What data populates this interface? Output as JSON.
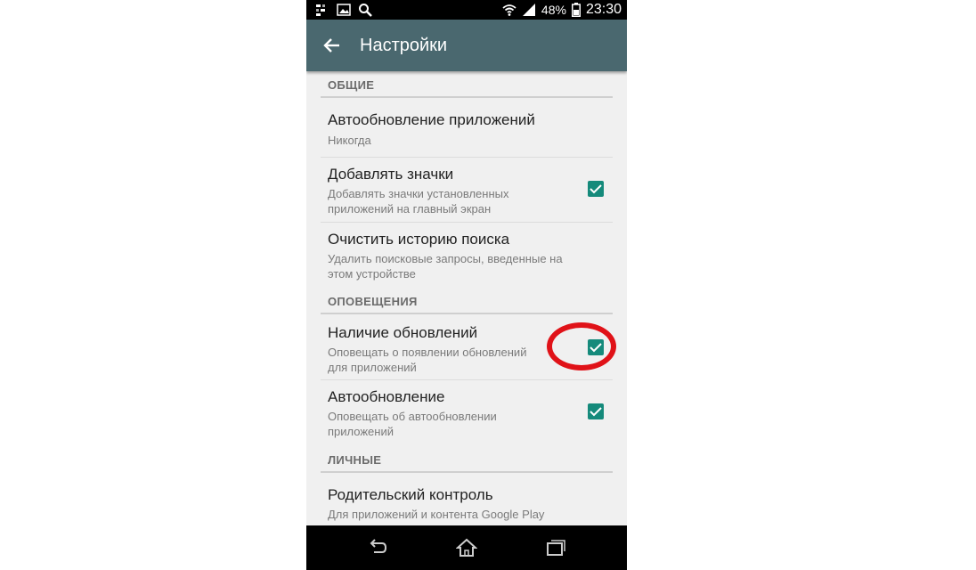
{
  "status_bar": {
    "battery": "48%",
    "time": "23:30",
    "icons": [
      "notification-icon",
      "image-icon",
      "search-icon",
      "wifi-icon",
      "signal-icon",
      "battery-icon"
    ]
  },
  "app_bar": {
    "title": "Настройки",
    "back_icon": "arrow-left-icon"
  },
  "sections": [
    {
      "title": "ОБЩИЕ",
      "items": [
        {
          "title": "Автообновление приложений",
          "subtitle": "Никогда",
          "checkbox": null
        },
        {
          "title": "Добавлять значки",
          "subtitle_lines": [
            "Добавлять значки установленных",
            "приложений на главный экран"
          ],
          "checkbox": true
        },
        {
          "title": "Очистить историю поиска",
          "subtitle_lines": [
            "Удалить поисковые запросы, введенные на",
            "этом устройстве"
          ],
          "checkbox": null
        }
      ]
    },
    {
      "title": "ОПОВЕЩЕНИЯ",
      "items": [
        {
          "title": "Наличие обновлений",
          "subtitle_lines": [
            "Оповещать о появлении обновлений",
            "для приложений"
          ],
          "checkbox": true
        },
        {
          "title": "Автообновление",
          "subtitle_lines": [
            "Оповещать об автообновлении",
            "приложений"
          ],
          "checkbox": true
        }
      ]
    },
    {
      "title": "ЛИЧНЫЕ",
      "items": [
        {
          "title": "Родительский контроль",
          "subtitle": "Для приложений и контента Google Play",
          "checkbox": null
        }
      ]
    }
  ],
  "nav_bar": {
    "icons": [
      "back-nav-icon",
      "home-icon",
      "recents-icon"
    ]
  },
  "colors": {
    "app_bar": "#4a686f",
    "checkbox": "#158a7b",
    "highlight": "#e01218"
  }
}
